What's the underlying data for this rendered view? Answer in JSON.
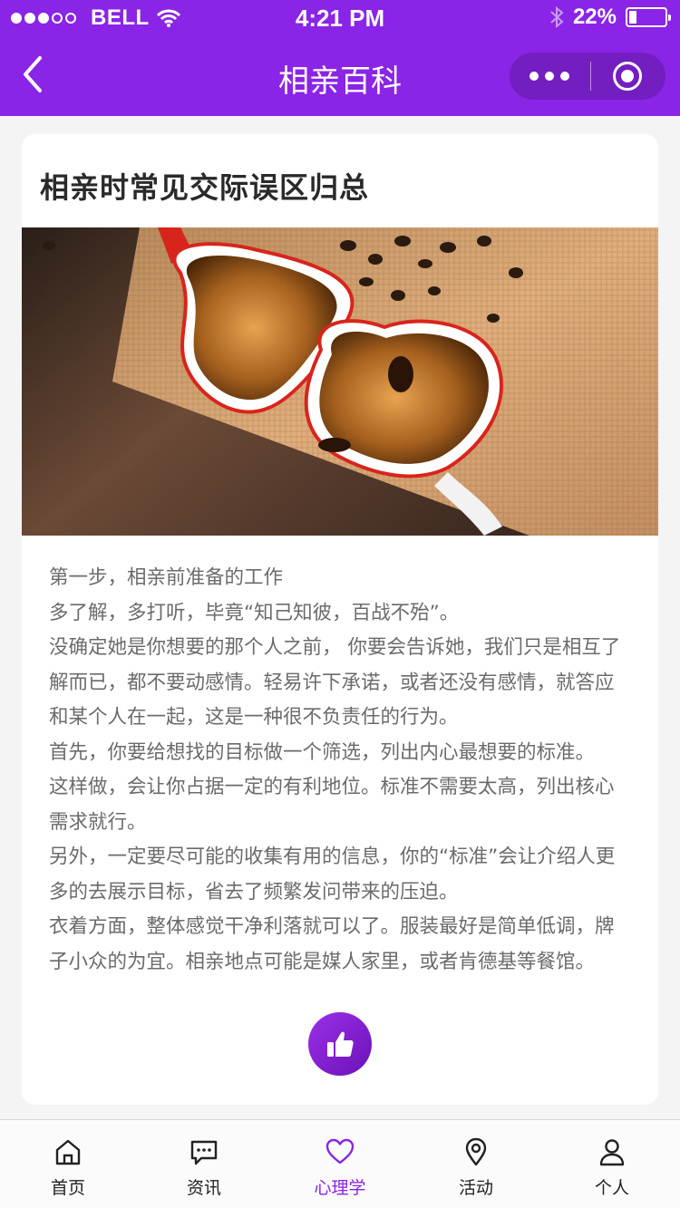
{
  "status_bar": {
    "carrier": "BELL",
    "time": "4:21 PM",
    "battery_text": "22%",
    "battery_level": 0.22,
    "signal_bars_filled": 3,
    "signal_bars_total": 5
  },
  "nav": {
    "title": "相亲百科"
  },
  "article": {
    "title": "相亲时常见交际误区归总",
    "image_icon": "heart-coffee-cups-image",
    "lines": [
      "第一步，相亲前准备的工作",
      "多了解，多打听，毕竟“知己知彼，百战不殆”。",
      "没确定她是你想要的那个人之前， 你要会告诉她，我们只是相互了",
      "解而已，都不要动感情。轻易许下承诺，或者还没有感情，就答应",
      "和某个人在一起，这是一种很不负责任的行为。",
      "首先，你要给想找的目标做一个筛选，列出内心最想要的标准。",
      "这样做，会让你占据一定的有利地位。标准不需要太高，列出核心",
      "需求就行。",
      "另外，一定要尽可能的收集有用的信息，你的“标准”会让介绍人更",
      "多的去展示目标，省去了频繁发问带来的压迫。",
      "衣着方面，整体感觉干净利落就可以了。服装最好是简单低调，牌",
      "子小众的为宜。相亲地点可能是媒人家里，或者肯德基等餐馆。"
    ],
    "like_icon": "thumbs-up-icon"
  },
  "tabs": [
    {
      "label": "首页",
      "icon": "home-icon",
      "active": false
    },
    {
      "label": "资讯",
      "icon": "chat-bubble-icon",
      "active": false
    },
    {
      "label": "心理学",
      "icon": "heart-icon",
      "active": true
    },
    {
      "label": "活动",
      "icon": "location-pin-icon",
      "active": false
    },
    {
      "label": "个人",
      "icon": "user-icon",
      "active": false
    }
  ],
  "colors": {
    "brand": "#8a24e6",
    "text_body": "#6b6b6b",
    "title": "#2a2a2a",
    "background": "#f4f4f5"
  }
}
